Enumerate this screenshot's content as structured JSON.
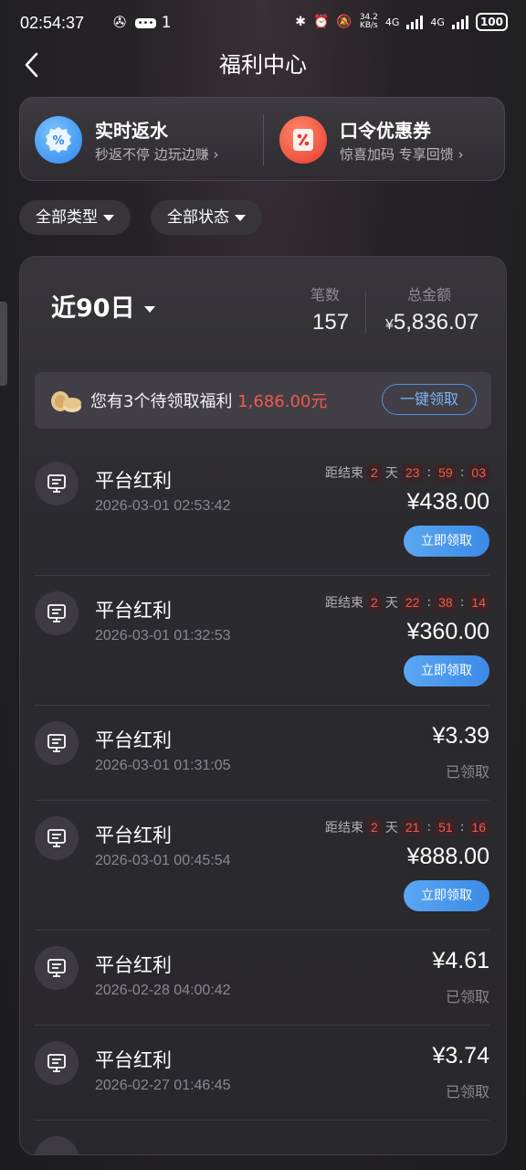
{
  "status_bar": {
    "time": "02:54:37",
    "notif_count": "1",
    "net_speed_value": "34.2",
    "net_speed_unit": "KB/s",
    "network_1": "4G",
    "network_2": "4G",
    "battery": "100"
  },
  "header": {
    "title": "福利中心"
  },
  "promo": {
    "left": {
      "title": "实时返水",
      "subtitle": "秒返不停 边玩边赚 ›",
      "icon": "percent-badge-icon",
      "color": "#3b9bf5"
    },
    "right": {
      "title": "口令优惠券",
      "subtitle": "惊喜加码 专享回馈 ›",
      "icon": "coupon-ticket-icon",
      "color": "#f24b3d"
    }
  },
  "filters": [
    {
      "label": "全部类型"
    },
    {
      "label": "全部状态"
    }
  ],
  "summary": {
    "period": "近90日",
    "count_label": "笔数",
    "count_value": "157",
    "total_label": "总金额",
    "total_currency": "¥",
    "total_value": "5,836.07"
  },
  "notice": {
    "text": "您有3个待领取福利",
    "amount": "1,686.00元",
    "button": "一键领取"
  },
  "records": [
    {
      "name": "平台红利",
      "date": "2026-03-01 02:53:42",
      "amount": "¥438.00",
      "cd_label": "距结束",
      "days": "2",
      "day_unit": "天",
      "hh": "23",
      "mm": "59",
      "ss": "03",
      "action": "立即领取"
    },
    {
      "name": "平台红利",
      "date": "2026-03-01 01:32:53",
      "amount": "¥360.00",
      "cd_label": "距结束",
      "days": "2",
      "day_unit": "天",
      "hh": "22",
      "mm": "38",
      "ss": "14",
      "action": "立即领取"
    },
    {
      "name": "平台红利",
      "date": "2026-03-01 01:31:05",
      "amount": "¥3.39",
      "status": "已领取"
    },
    {
      "name": "平台红利",
      "date": "2026-03-01 00:45:54",
      "amount": "¥888.00",
      "cd_label": "距结束",
      "days": "2",
      "day_unit": "天",
      "hh": "21",
      "mm": "51",
      "ss": "16",
      "action": "立即领取"
    },
    {
      "name": "平台红利",
      "date": "2026-02-28 04:00:42",
      "amount": "¥4.61",
      "status": "已领取"
    },
    {
      "name": "平台红利",
      "date": "2026-02-27 01:46:45",
      "amount": "¥3.74",
      "status": "已领取"
    }
  ],
  "colors": {
    "accent_blue": "#4d8fe8",
    "accent_red": "#f2594f"
  }
}
